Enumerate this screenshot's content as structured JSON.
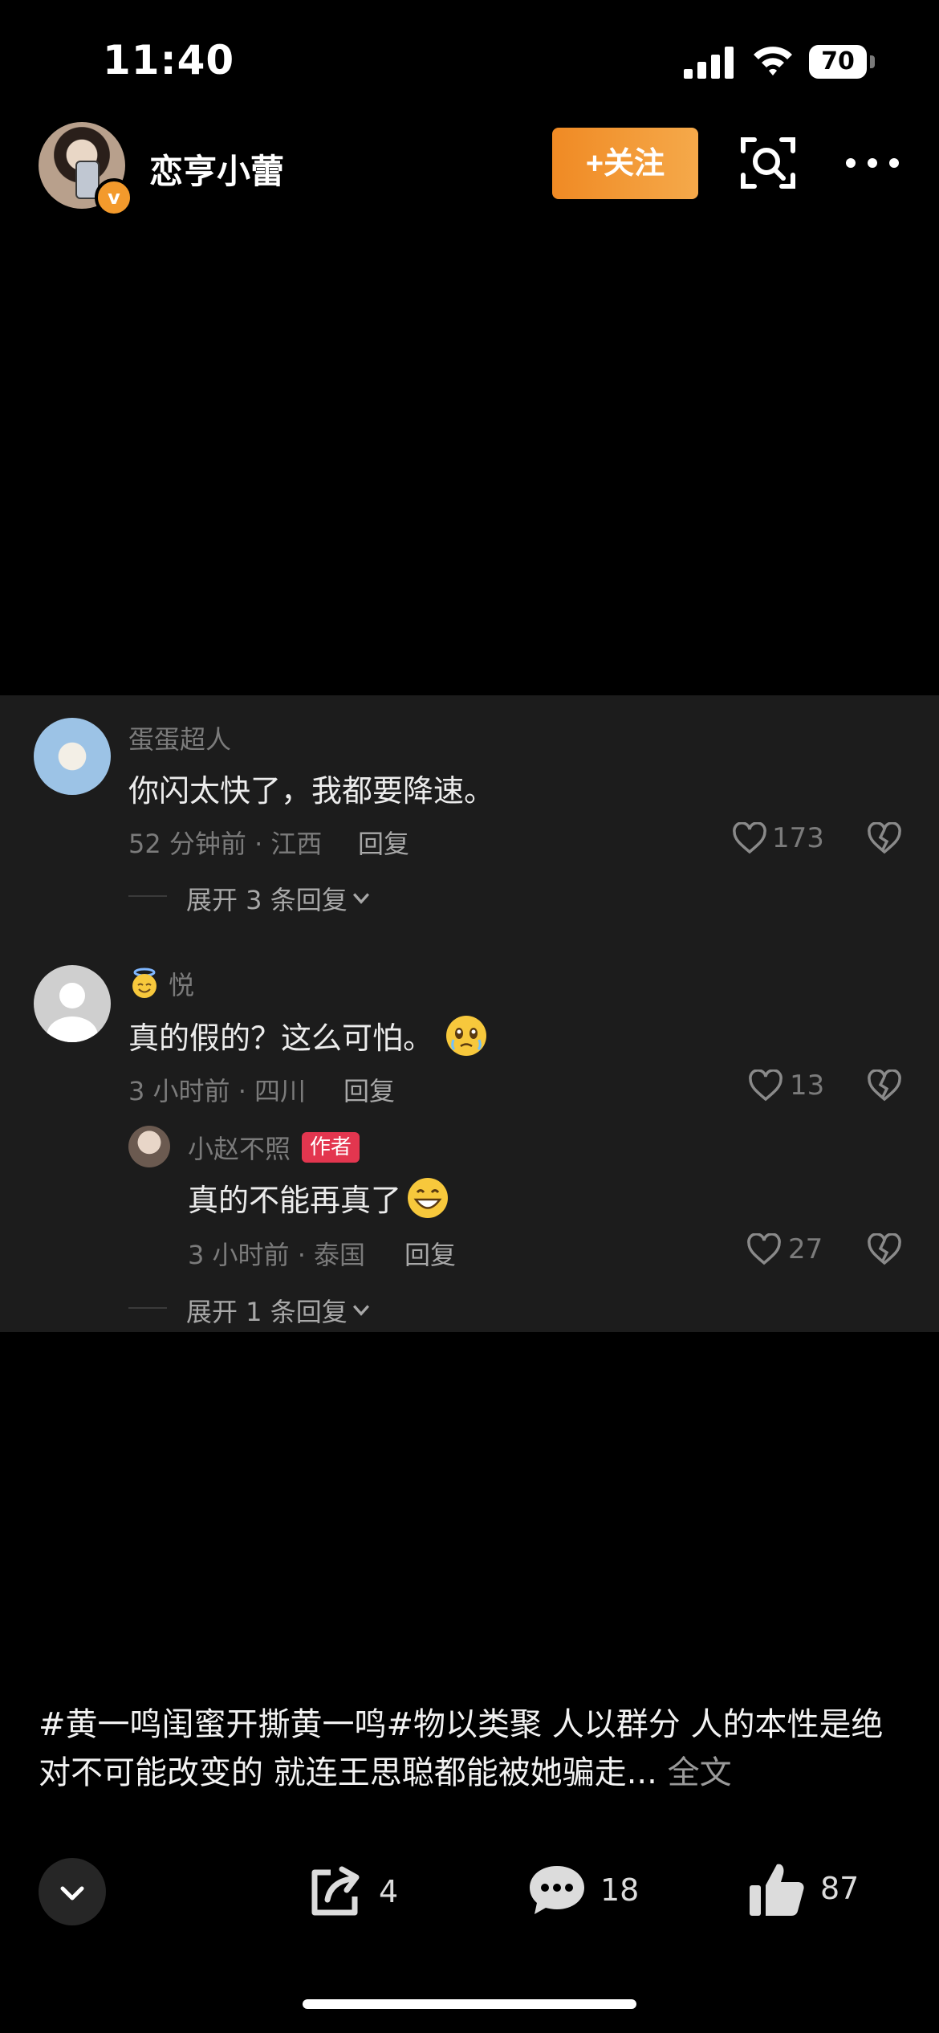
{
  "status_bar": {
    "time": "11:40",
    "battery": "70"
  },
  "header": {
    "username": "恋亨小蕾",
    "follow_label": "+关注"
  },
  "comments": [
    {
      "name": "蛋蛋超人",
      "text": "你闪太快了，我都要降速。",
      "meta": "52 分钟前 · 江西",
      "reply_label": "回复",
      "likes": "173",
      "expand_label": "展开 3 条回复"
    },
    {
      "name": "悦",
      "text": "真的假的？这么可怕。",
      "meta": "3 小时前 · 四川",
      "reply_label": "回复",
      "likes": "13",
      "reply": {
        "name": "小赵不照",
        "tag": "作者",
        "text": "真的不能再真了",
        "meta": "3 小时前 · 泰国",
        "reply_label": "回复",
        "likes": "27"
      },
      "expand_label": "展开 1 条回复"
    }
  ],
  "caption": {
    "text": "#黄一鸣闺蜜开撕黄一鸣#物以类聚 人以群分 人的本性是绝对不可能改变的 就连王思聪都能被她骗走...",
    "more_label": "全文"
  },
  "actions": {
    "share_count": "4",
    "comment_count": "18",
    "like_count": "87"
  },
  "colors": {
    "accent": "#f08a24",
    "panel_bg": "#1c1c1c",
    "author_tag": "#e3364f"
  }
}
